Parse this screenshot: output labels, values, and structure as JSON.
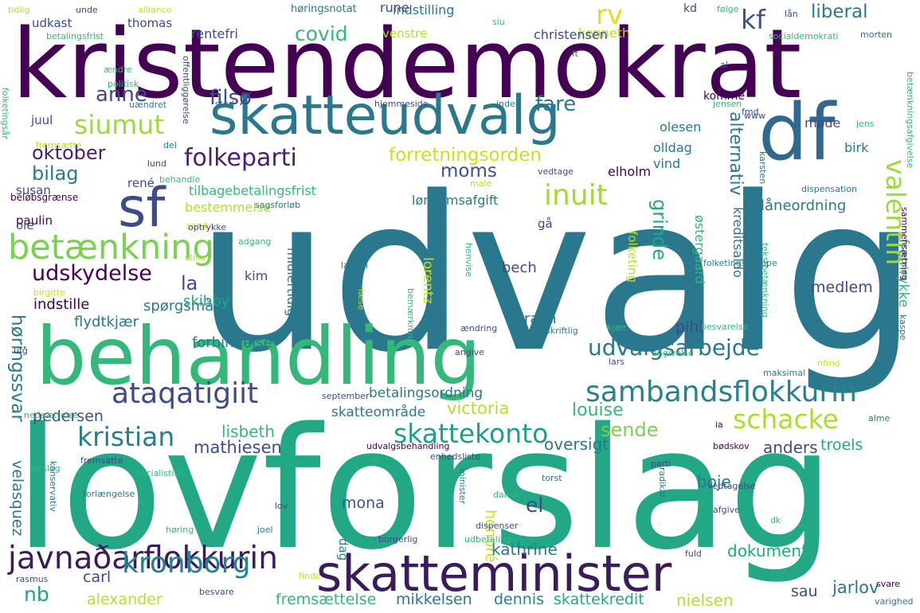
{
  "words": [
    {
      "text": "udvalg",
      "color": "#2a788e"
    },
    {
      "text": "lovforslag",
      "color": "#22a884"
    },
    {
      "text": "kristendemokrat",
      "color": "#440154"
    },
    {
      "text": "behandling",
      "color": "#35b779"
    },
    {
      "text": "skatteudvalg",
      "color": "#2a788e"
    },
    {
      "text": "skatteminister",
      "color": "#3b1c5a"
    },
    {
      "text": "df",
      "color": "#31688e"
    },
    {
      "text": "sf",
      "color": "#3e4a89"
    },
    {
      "text": "siumut",
      "color": "#a0da39"
    },
    {
      "text": "betænkning",
      "color": "#7ad151"
    },
    {
      "text": "sambandsflokkurin",
      "color": "#26828e"
    },
    {
      "text": "ataqatigiit",
      "color": "#3e4a89"
    },
    {
      "text": "javnaðarflokkurin",
      "color": "#3b1c5a"
    },
    {
      "text": "kronborg",
      "color": "#26828e"
    },
    {
      "text": "skattekonto",
      "color": "#1f9e89"
    },
    {
      "text": "kristian",
      "color": "#287d8e"
    },
    {
      "text": "schacke",
      "color": "#addc30"
    },
    {
      "text": "inuit",
      "color": "#a0da39"
    },
    {
      "text": "valentin",
      "color": "#a0da39"
    },
    {
      "text": "udvalgsarbejde",
      "color": "#2a788e"
    },
    {
      "text": "folkeparti",
      "color": "#481f70"
    },
    {
      "text": "forretningsorden",
      "color": "#c8e020"
    },
    {
      "text": "anne",
      "color": "#3e4a89"
    },
    {
      "text": "filsø",
      "color": "#3e4a89"
    },
    {
      "text": "rv",
      "color": "#dde318"
    },
    {
      "text": "kf",
      "color": "#3b528b"
    },
    {
      "text": "liberal",
      "color": "#2a788e"
    },
    {
      "text": "covid",
      "color": "#35b779"
    },
    {
      "text": "fare",
      "color": "#2a788e"
    },
    {
      "text": "oktober",
      "color": "#481f70"
    },
    {
      "text": "bilag",
      "color": "#2a788e"
    },
    {
      "text": "moms",
      "color": "#3b528b"
    },
    {
      "text": "udskydelse",
      "color": "#440154"
    },
    {
      "text": "la",
      "color": "#3e4a89"
    },
    {
      "text": "el",
      "color": "#3e4a89"
    },
    {
      "text": "alternativ",
      "color": "#2a788e"
    },
    {
      "text": "grinde",
      "color": "#22a884"
    },
    {
      "text": "høringssvar",
      "color": "#2a788e"
    },
    {
      "text": "nb",
      "color": "#1fa187"
    },
    {
      "text": "sende",
      "color": "#7ad151"
    },
    {
      "text": "louise",
      "color": "#35b779"
    },
    {
      "text": "victoria",
      "color": "#b5de2b"
    },
    {
      "text": "lisbeth",
      "color": "#35b779"
    },
    {
      "text": "mathiesen",
      "color": "#3e4a89"
    },
    {
      "text": "oversigt",
      "color": "#2a788e"
    },
    {
      "text": "anders",
      "color": "#3e4a89"
    },
    {
      "text": "troels",
      "color": "#22a884"
    },
    {
      "text": "boje",
      "color": "#2a788e"
    },
    {
      "text": "mona",
      "color": "#3b528b"
    },
    {
      "text": "honoré",
      "color": "#c8e020"
    },
    {
      "text": "kathrine",
      "color": "#2a788e"
    },
    {
      "text": "dokument",
      "color": "#22a884"
    },
    {
      "text": "alexander",
      "color": "#b5de2b"
    },
    {
      "text": "fremsættelse",
      "color": "#35b779"
    },
    {
      "text": "mikkelsen",
      "color": "#2a788e"
    },
    {
      "text": "dennis",
      "color": "#26828e"
    },
    {
      "text": "skattekredit",
      "color": "#22a884"
    },
    {
      "text": "nielsen",
      "color": "#b5de2b"
    },
    {
      "text": "sau",
      "color": "#3e4a89"
    },
    {
      "text": "jarlov",
      "color": "#2a788e"
    },
    {
      "text": "carl",
      "color": "#3e4a89"
    },
    {
      "text": "velasquez",
      "color": "#2a788e"
    },
    {
      "text": "pedersen",
      "color": "#3e4a89"
    },
    {
      "text": "betalingsordning",
      "color": "#2a788e"
    },
    {
      "text": "skatteområde",
      "color": "#2a788e"
    },
    {
      "text": "indstille",
      "color": "#440154"
    },
    {
      "text": "spørgsmål",
      "color": "#2a788e"
    },
    {
      "text": "skibby",
      "color": "#22a884"
    },
    {
      "text": "flydtkjær",
      "color": "#2a788e"
    },
    {
      "text": "forbindelse",
      "color": "#2a788e"
    },
    {
      "text": "lorentz",
      "color": "#c8e020"
    },
    {
      "text": "ravn",
      "color": "#2a788e"
    },
    {
      "text": "pihl",
      "color": "#3e4a89"
    },
    {
      "text": "bech",
      "color": "#3e4a89"
    },
    {
      "text": "medlem",
      "color": "#3e4a89"
    },
    {
      "text": "kim",
      "color": "#3e4a89"
    },
    {
      "text": "midlertidig",
      "color": "#2a788e"
    },
    {
      "text": "fremrykke",
      "color": "#35b779"
    },
    {
      "text": "kreditsaldo",
      "color": "#2a788e"
    },
    {
      "text": "østergaard",
      "color": "#35b779"
    },
    {
      "text": "låneordning",
      "color": "#2a788e"
    },
    {
      "text": "lønsumsafgift",
      "color": "#2a788e"
    },
    {
      "text": "tilbagebetalingsfrist",
      "color": "#35b779"
    },
    {
      "text": "bestemmelse",
      "color": "#b5de2b"
    },
    {
      "text": "elholm",
      "color": "#440154"
    },
    {
      "text": "vind",
      "color": "#2a788e"
    },
    {
      "text": "olldag",
      "color": "#2a788e"
    },
    {
      "text": "olesen",
      "color": "#2a788e"
    },
    {
      "text": "birk",
      "color": "#2a788e"
    },
    {
      "text": "møde",
      "color": "#3e4a89"
    },
    {
      "text": "komme",
      "color": "#440154"
    },
    {
      "text": "kenneth",
      "color": "#b5de2b"
    },
    {
      "text": "christensen",
      "color": "#3e4a89"
    },
    {
      "text": "rentefri",
      "color": "#3e4a89"
    },
    {
      "text": "udkast",
      "color": "#3e4a89"
    },
    {
      "text": "thomas",
      "color": "#3e4a89"
    },
    {
      "text": "indstilling",
      "color": "#2a788e"
    },
    {
      "text": "rune",
      "color": "#3e4a89"
    },
    {
      "text": "venstre",
      "color": "#b5de2b"
    },
    {
      "text": "juul",
      "color": "#3e4a89"
    },
    {
      "text": "susan",
      "color": "#3e4a89"
    },
    {
      "text": "paulin",
      "color": "#440154"
    },
    {
      "text": "ole",
      "color": "#3e4a89"
    },
    {
      "text": "rené",
      "color": "#3e4a89"
    },
    {
      "text": "gå",
      "color": "#3e4a89"
    },
    {
      "text": "folketing",
      "color": "#b5de2b"
    },
    {
      "text": "dag",
      "color": "#2a788e"
    },
    {
      "text": "høringsnotat",
      "color": "#2a788e"
    },
    {
      "text": "alliance",
      "color": "#c8e020"
    },
    {
      "text": "tidlig",
      "color": "#b5de2b"
    },
    {
      "text": "unde",
      "color": "#3e4a89"
    },
    {
      "text": "betalingsfrist",
      "color": "#35b779"
    },
    {
      "text": "siu",
      "color": "#35b779"
    },
    {
      "text": "kd",
      "color": "#3e4a89"
    },
    {
      "text": "følge",
      "color": "#35b779"
    },
    {
      "text": "lån",
      "color": "#3e4a89"
    },
    {
      "text": "socialdemokrati",
      "color": "#35b779"
    },
    {
      "text": "morten",
      "color": "#2a788e"
    },
    {
      "text": "folketingsår",
      "color": "#35b779"
    },
    {
      "text": "ændre",
      "color": "#35b779"
    },
    {
      "text": "politisk",
      "color": "#35b779"
    },
    {
      "text": "uændret",
      "color": "#2a788e"
    },
    {
      "text": "offentliggørelse",
      "color": "#3e4a89"
    },
    {
      "text": "sted",
      "color": "#2a788e"
    },
    {
      "text": "hjemmeside",
      "color": "#3e4a89"
    },
    {
      "text": "inden",
      "color": "#2a788e"
    },
    {
      "text": "jensen",
      "color": "#35b779"
    },
    {
      "text": "al",
      "color": "#3e4a89"
    },
    {
      "text": "fmd",
      "color": "#3e4a89"
    },
    {
      "text": "www",
      "color": "#3e4a89"
    },
    {
      "text": "jens",
      "color": "#35b779"
    },
    {
      "text": "betænkningsafgivelse",
      "color": "#35b779"
    },
    {
      "text": "fremsætte",
      "color": "#b5de2b"
    },
    {
      "text": "del",
      "color": "#2a788e"
    },
    {
      "text": "lund",
      "color": "#3e4a89"
    },
    {
      "text": "behandle",
      "color": "#35b779"
    },
    {
      "text": "vedtage",
      "color": "#3e4a89"
    },
    {
      "text": "karsten",
      "color": "#2a788e"
    },
    {
      "text": "beløbsgrænse",
      "color": "#440154"
    },
    {
      "text": "sagsforløb",
      "color": "#2a788e"
    },
    {
      "text": "male",
      "color": "#b5de2b"
    },
    {
      "text": "dispensation",
      "color": "#2a788e"
    },
    {
      "text": "sand",
      "color": "#c8e020"
    },
    {
      "text": "optrykke",
      "color": "#3e4a89"
    },
    {
      "text": "stille",
      "color": "#b5de2b"
    },
    {
      "text": "adgang",
      "color": "#35b779"
    },
    {
      "text": "henvise",
      "color": "#35b779"
    },
    {
      "text": "danmark",
      "color": "#2a788e"
    },
    {
      "text": "tekstbetænkning",
      "color": "#35b779"
    },
    {
      "text": "folketingsgruppe",
      "color": "#2a788e"
    },
    {
      "text": "sammensætning",
      "color": "#440154"
    },
    {
      "text": "birgitte",
      "color": "#c8e020"
    },
    {
      "text": "larsen",
      "color": "#2a788e"
    },
    {
      "text": "læse",
      "color": "#b5de2b"
    },
    {
      "text": "bemærkning",
      "color": "#35b779"
    },
    {
      "text": "ændring",
      "color": "#3e4a89"
    },
    {
      "text": "skriftlig",
      "color": "#2a788e"
    },
    {
      "text": "kjær",
      "color": "#35b779"
    },
    {
      "text": "besvarelse",
      "color": "#35b779"
    },
    {
      "text": "kaspe",
      "color": "#2a788e"
    },
    {
      "text": "ufg",
      "color": "#3e4a89"
    },
    {
      "text": "angive",
      "color": "#3e4a89"
    },
    {
      "text": "lars",
      "color": "#3e4a89"
    },
    {
      "text": "angivelse",
      "color": "#35b779"
    },
    {
      "text": "nfmd",
      "color": "#c8e020"
    },
    {
      "text": "september",
      "color": "#3e4a89"
    },
    {
      "text": "nedsættelse",
      "color": "#35b779"
    },
    {
      "text": "maksimal",
      "color": "#2a788e"
    },
    {
      "text": "alme",
      "color": "#2a788e"
    },
    {
      "text": "udvalgsbehandling",
      "color": "#440154"
    },
    {
      "text": "enhedsliste",
      "color": "#3e4a89"
    },
    {
      "text": "ia",
      "color": "#440154"
    },
    {
      "text": "bødskov",
      "color": "#440154"
    },
    {
      "text": "forslag",
      "color": "#35b779"
    },
    {
      "text": "socialistisk",
      "color": "#35b779"
    },
    {
      "text": "sp",
      "color": "#35b779"
    },
    {
      "text": "parti",
      "color": "#3e4a89"
    },
    {
      "text": "radikal",
      "color": "#2a788e"
    },
    {
      "text": "konservativ",
      "color": "#2a788e"
    },
    {
      "text": "fremsatte",
      "color": "#3e4a89"
    },
    {
      "text": "dansk",
      "color": "#35b779"
    },
    {
      "text": "torst",
      "color": "#2a788e"
    },
    {
      "text": "vedtagelse",
      "color": "#3e4a89"
    },
    {
      "text": "forlængelse",
      "color": "#2a788e"
    },
    {
      "text": "lov",
      "color": "#3e4a89"
    },
    {
      "text": "minister",
      "color": "#2a788e"
    },
    {
      "text": "dispenser",
      "color": "#3e4a89"
    },
    {
      "text": "afgive",
      "color": "#3e4a89"
    },
    {
      "text": "høring",
      "color": "#35b779"
    },
    {
      "text": "joel",
      "color": "#2a788e"
    },
    {
      "text": "udbetaling",
      "color": "#35b779"
    },
    {
      "text": "dk",
      "color": "#35b779"
    },
    {
      "text": "borgerlig",
      "color": "#3e4a89"
    },
    {
      "text": "fuld",
      "color": "#3e4a89"
    },
    {
      "text": "rasmus",
      "color": "#3e4a89"
    },
    {
      "text": "finde",
      "color": "#c8e020"
    },
    {
      "text": "besvare",
      "color": "#3e4a89"
    },
    {
      "text": "svare",
      "color": "#440154"
    },
    {
      "text": "varighed",
      "color": "#2a788e"
    },
    {
      "text": "ft",
      "color": "#2a788e"
    }
  ]
}
